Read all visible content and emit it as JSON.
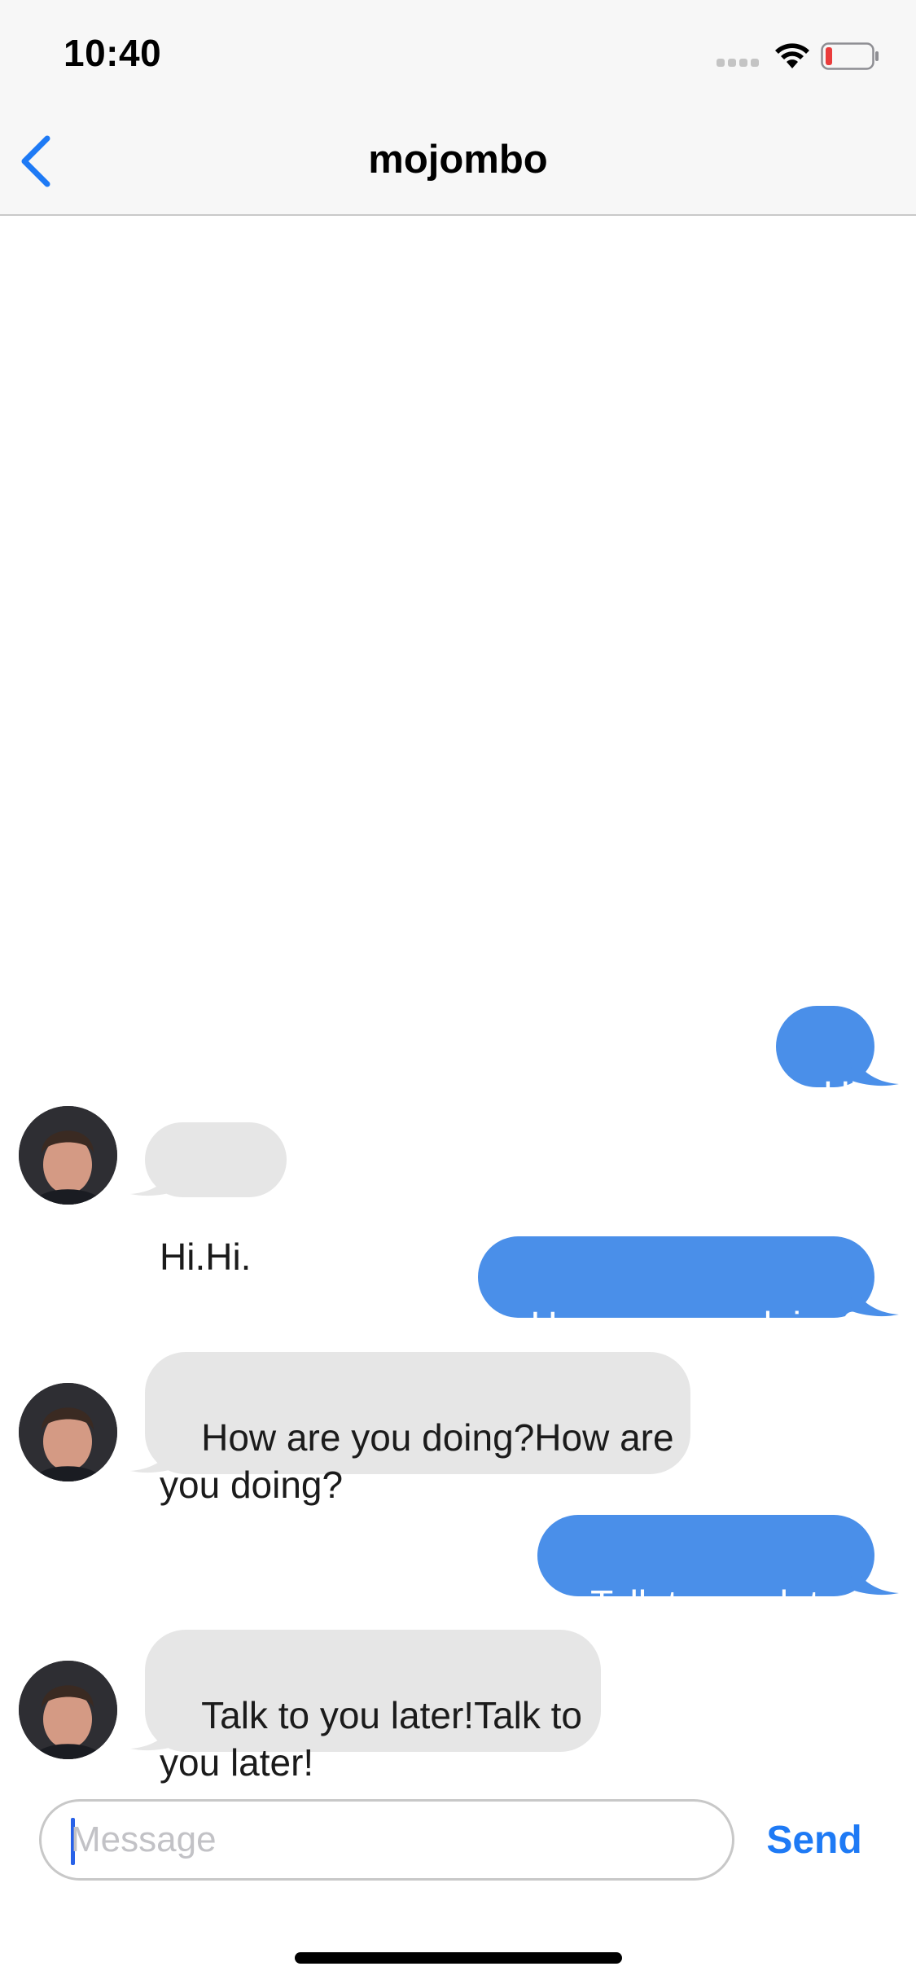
{
  "status_bar": {
    "time": "10:40",
    "signal_icon": "signal-dots-icon",
    "wifi_icon": "wifi-icon",
    "battery_icon": "battery-low-icon",
    "battery_color": "#ea3c3c"
  },
  "nav": {
    "back_icon": "chevron-left-icon",
    "title": "mojombo",
    "accent": "#1e7af5"
  },
  "messages": [
    {
      "direction": "outgoing",
      "text": "Hi."
    },
    {
      "direction": "incoming",
      "text": "Hi.Hi."
    },
    {
      "direction": "outgoing",
      "text": "How are you doing?"
    },
    {
      "direction": "incoming",
      "text": "How are you doing?How are\nyou doing?"
    },
    {
      "direction": "outgoing",
      "text": "Talk to you later!"
    },
    {
      "direction": "incoming",
      "text": "Talk to you later!Talk to\nyou later!"
    }
  ],
  "colors": {
    "outgoing_bubble": "#4a8fe9",
    "incoming_bubble": "#e6e6e6"
  },
  "composer": {
    "placeholder": "Message",
    "value": "",
    "send_label": "Send"
  }
}
